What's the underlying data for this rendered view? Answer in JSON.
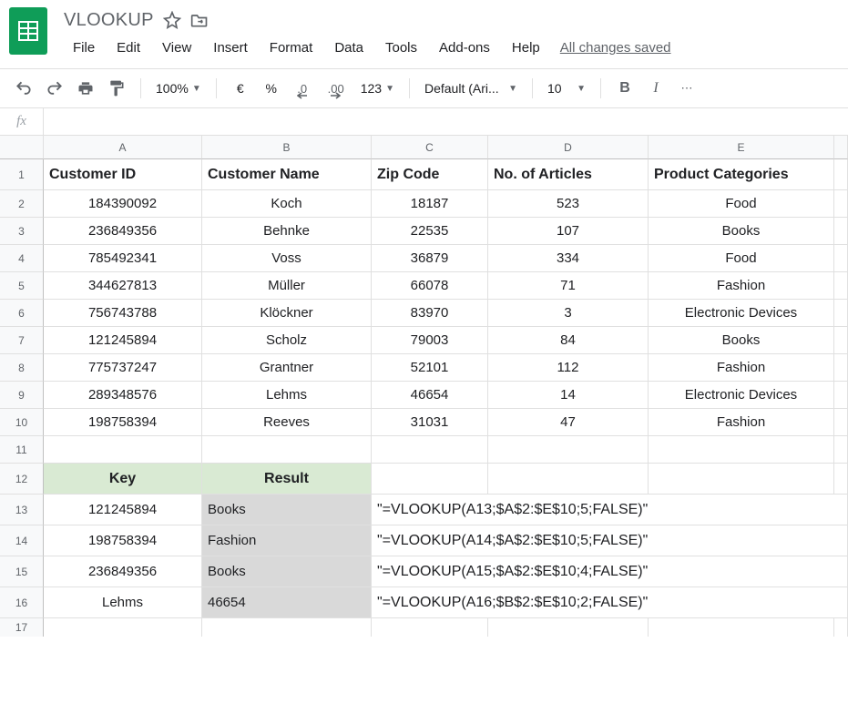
{
  "doc": {
    "title": "VLOOKUP"
  },
  "menu": {
    "file": "File",
    "edit": "Edit",
    "view": "View",
    "insert": "Insert",
    "format": "Format",
    "data": "Data",
    "tools": "Tools",
    "addons": "Add-ons",
    "help": "Help",
    "save_status": "All changes saved"
  },
  "toolbar": {
    "zoom": "100%",
    "currency": "€",
    "percent": "%",
    "dec_less": ".0",
    "dec_more": ".00",
    "fmt_more": "123",
    "font": "Default (Ari...",
    "size": "10",
    "bold": "B",
    "italic": "I"
  },
  "formula_bar": {
    "fx": "fx",
    "value": ""
  },
  "columns": [
    "A",
    "B",
    "C",
    "D",
    "E"
  ],
  "rows": [
    "1",
    "2",
    "3",
    "4",
    "5",
    "6",
    "7",
    "8",
    "9",
    "10",
    "11",
    "12",
    "13",
    "14",
    "15",
    "16",
    "17"
  ],
  "headers": {
    "A": "Customer ID",
    "B": "Customer Name",
    "C": "Zip Code",
    "D": "No. of Articles",
    "E": "Product Categories"
  },
  "data": [
    {
      "id": "184390092",
      "name": "Koch",
      "zip": "18187",
      "art": "523",
      "cat": "Food"
    },
    {
      "id": "236849356",
      "name": "Behnke",
      "zip": "22535",
      "art": "107",
      "cat": "Books"
    },
    {
      "id": "785492341",
      "name": "Voss",
      "zip": "36879",
      "art": "334",
      "cat": "Food"
    },
    {
      "id": "344627813",
      "name": "Müller",
      "zip": "66078",
      "art": "71",
      "cat": "Fashion"
    },
    {
      "id": "756743788",
      "name": "Klöckner",
      "zip": "83970",
      "art": "3",
      "cat": "Electronic Devices"
    },
    {
      "id": "121245894",
      "name": "Scholz",
      "zip": "79003",
      "art": "84",
      "cat": "Books"
    },
    {
      "id": "775737247",
      "name": "Grantner",
      "zip": "52101",
      "art": "112",
      "cat": "Fashion"
    },
    {
      "id": "289348576",
      "name": "Lehms",
      "zip": "46654",
      "art": "14",
      "cat": "Electronic Devices"
    },
    {
      "id": "198758394",
      "name": "Reeves",
      "zip": "31031",
      "art": "47",
      "cat": "Fashion"
    }
  ],
  "section2_headers": {
    "key": "Key",
    "result": "Result"
  },
  "lookups": [
    {
      "key": "121245894",
      "result": "Books",
      "formula": "\"=VLOOKUP(A13;$A$2:$E$10;5;FALSE)\""
    },
    {
      "key": "198758394",
      "result": "Fashion",
      "formula": "\"=VLOOKUP(A14;$A$2:$E$10;5;FALSE)\""
    },
    {
      "key": "236849356",
      "result": "Books",
      "formula": "\"=VLOOKUP(A15;$A$2:$E$10;4;FALSE)\""
    },
    {
      "key": "Lehms",
      "result": "46654",
      "formula": "\"=VLOOKUP(A16;$B$2:$E$10;2;FALSE)\""
    }
  ]
}
